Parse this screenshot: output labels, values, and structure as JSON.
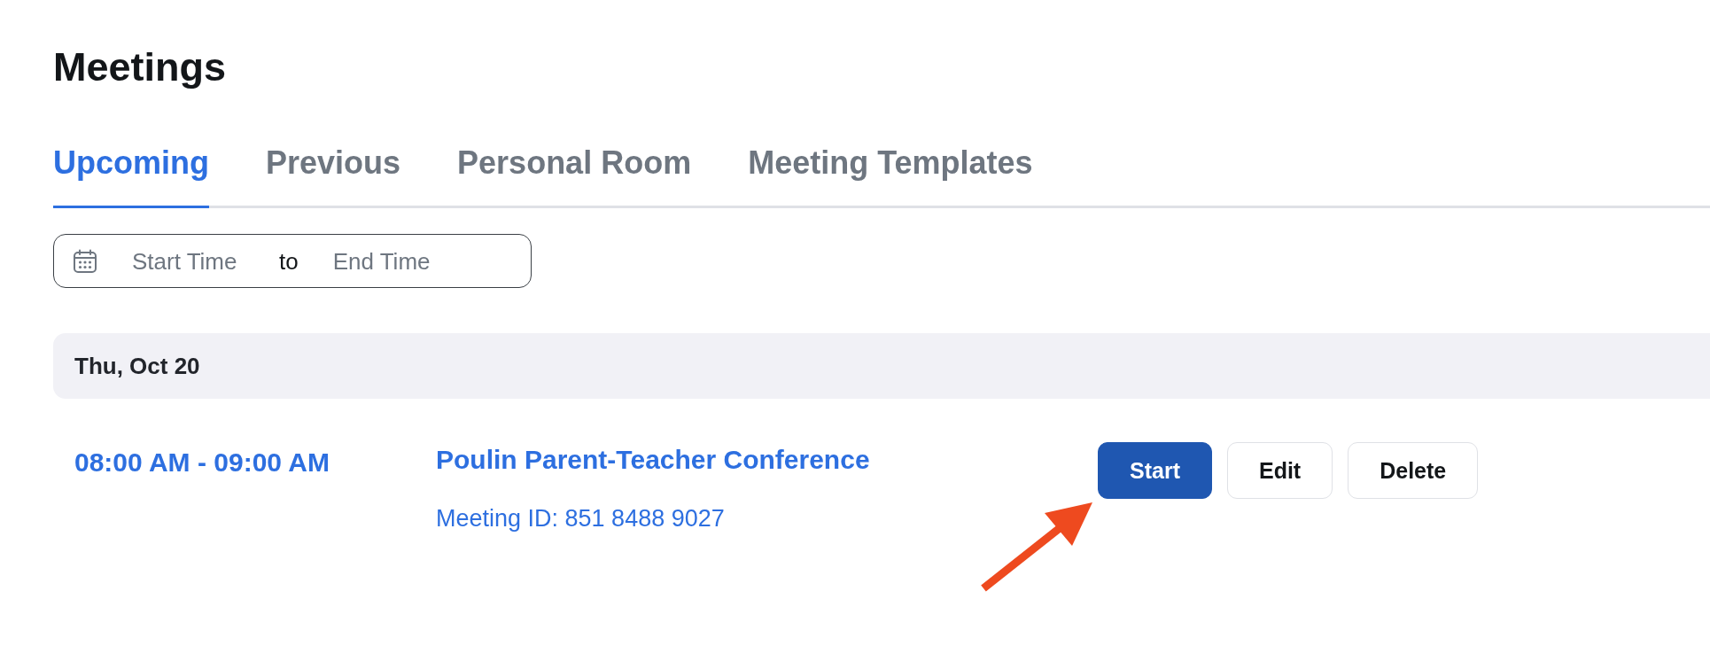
{
  "page": {
    "title": "Meetings"
  },
  "tabs": [
    {
      "label": "Upcoming",
      "selected": true
    },
    {
      "label": "Previous",
      "selected": false
    },
    {
      "label": "Personal Room",
      "selected": false
    },
    {
      "label": "Meeting Templates",
      "selected": false
    }
  ],
  "date_range": {
    "start": {
      "placeholder": "Start Time"
    },
    "separator": "to",
    "end": {
      "placeholder": "End Time"
    }
  },
  "groups": [
    {
      "date": "Thu, Oct 20",
      "meetings": [
        {
          "time": "08:00 AM - 09:00 AM",
          "topic": "Poulin Parent-Teacher Conference",
          "meeting_id": "Meeting ID: 851 8488 9027",
          "actions": [
            {
              "label": "Start",
              "kind": "primary"
            },
            {
              "label": "Edit",
              "kind": "secondary"
            },
            {
              "label": "Delete",
              "kind": "secondary"
            }
          ]
        }
      ]
    }
  ],
  "annotations": [
    {
      "kind": "arrow"
    }
  ]
}
